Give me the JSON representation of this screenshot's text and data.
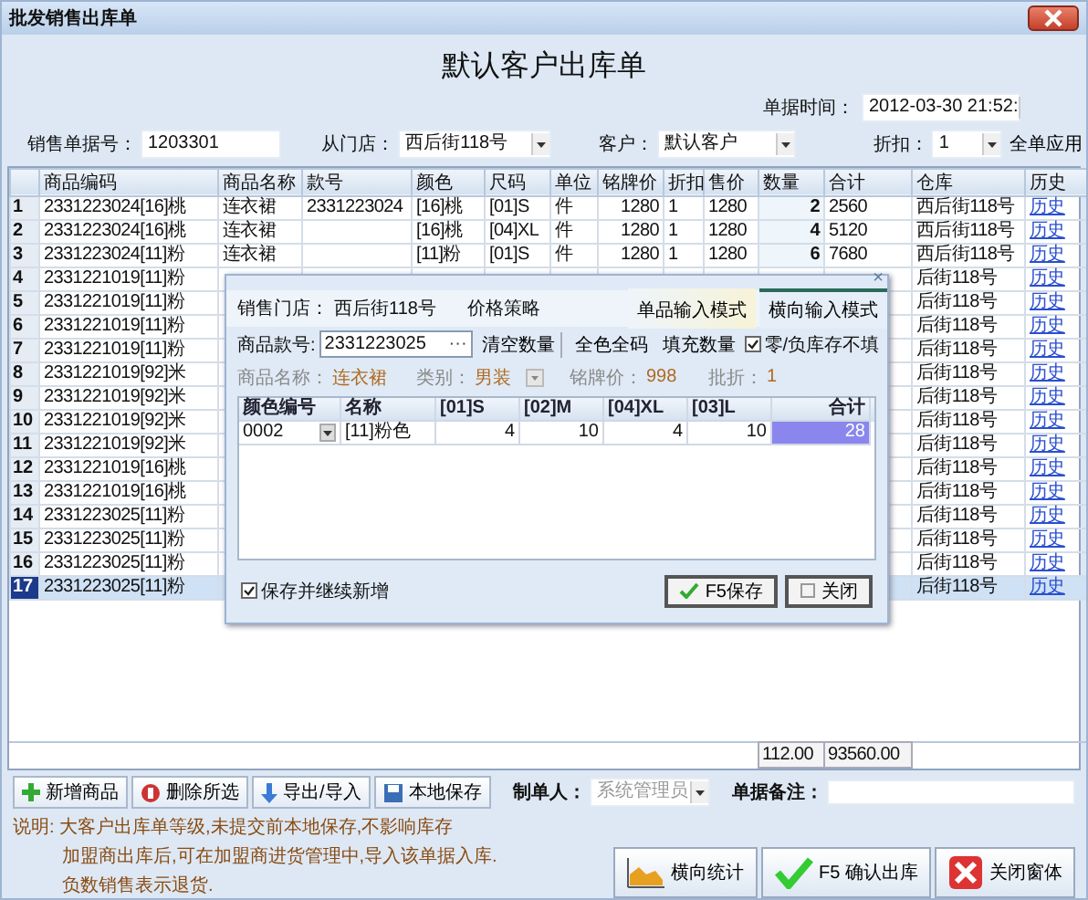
{
  "window": {
    "title": "批发销售出库单"
  },
  "heading": "默认客户出库单",
  "date": {
    "label": "单据时间：",
    "value": "2012-03-30 21:52:"
  },
  "fields": [
    {
      "kind": "input",
      "label": "销售单据号：",
      "value": "1203301"
    },
    {
      "kind": "combo",
      "label": "从门店：",
      "value": "西后街118号"
    },
    {
      "kind": "combo",
      "label": "客户：",
      "value": "默认客户"
    },
    {
      "kind": "combo",
      "label": "折扣：",
      "value": "1"
    }
  ],
  "apply_all": "全单应用",
  "table": {
    "columns": [
      "商品编码",
      "商品名称",
      "款号",
      "颜色",
      "尺码",
      "单位",
      "铭牌价",
      "折扣",
      "售价",
      "数量",
      "合计",
      "仓库",
      "历史"
    ],
    "rows": [
      {
        "no": "1",
        "code": "2331223024[16]桃",
        "name": "连衣裙",
        "style": "2331223024",
        "shade": "[16]桃",
        "size": "[01]S",
        "unit": "件",
        "list_price": "1280",
        "discount": "1",
        "price": "1280",
        "qty": "2",
        "total": "2560",
        "warehouse": "西后街118号",
        "history": "历史",
        "selected": false
      },
      {
        "no": "2",
        "code": "2331223024[16]桃",
        "name": "连衣裙",
        "shade": "[16]桃",
        "size": "[04]XL",
        "unit": "件",
        "list_price": "1280",
        "discount": "1",
        "price": "1280",
        "qty": "4",
        "total": "5120",
        "warehouse": "西后街118号",
        "history": "历史",
        "selected": false
      },
      {
        "no": "3",
        "code": "2331223024[11]粉",
        "name": "连衣裙",
        "shade": "[11]粉",
        "size": "[01]S",
        "unit": "件",
        "list_price": "1280",
        "discount": "1",
        "price": "1280",
        "qty": "6",
        "total": "7680",
        "warehouse": "西后街118号",
        "history": "历史",
        "selected": false
      },
      {
        "no": "4",
        "code": "2331221019[11]粉",
        "warehouse": "后街118号",
        "history": "历史",
        "selected": false
      },
      {
        "no": "5",
        "code": "2331221019[11]粉",
        "warehouse": "后街118号",
        "history": "历史",
        "selected": false
      },
      {
        "no": "6",
        "code": "2331221019[11]粉",
        "warehouse": "后街118号",
        "history": "历史",
        "selected": false
      },
      {
        "no": "7",
        "code": "2331221019[11]粉",
        "warehouse": "后街118号",
        "history": "历史",
        "selected": false
      },
      {
        "no": "8",
        "code": "2331221019[92]米",
        "warehouse": "后街118号",
        "history": "历史",
        "selected": false
      },
      {
        "no": "9",
        "code": "2331221019[92]米",
        "warehouse": "后街118号",
        "history": "历史",
        "selected": false
      },
      {
        "no": "10",
        "code": "2331221019[92]米",
        "warehouse": "后街118号",
        "history": "历史",
        "selected": false
      },
      {
        "no": "11",
        "code": "2331221019[92]米",
        "warehouse": "后街118号",
        "history": "历史",
        "selected": false
      },
      {
        "no": "12",
        "code": "2331221019[16]桃",
        "warehouse": "后街118号",
        "history": "历史",
        "selected": false
      },
      {
        "no": "13",
        "code": "2331221019[16]桃",
        "warehouse": "后街118号",
        "history": "历史",
        "selected": false
      },
      {
        "no": "14",
        "code": "2331223025[11]粉",
        "warehouse": "后街118号",
        "history": "历史",
        "selected": false
      },
      {
        "no": "15",
        "code": "2331223025[11]粉",
        "warehouse": "后街118号",
        "history": "历史",
        "selected": false
      },
      {
        "no": "16",
        "code": "2331223025[11]粉",
        "warehouse": "后街118号",
        "history": "历史",
        "selected": false
      },
      {
        "no": "17",
        "code": "2331223025[11]粉",
        "warehouse": "后街118号",
        "history": "历史",
        "selected": true
      }
    ],
    "summary": {
      "qty": "112.00",
      "total": "93560.00"
    }
  },
  "dialog": {
    "close_mark": "×",
    "store_label": "销售门店：",
    "store": "西后街118号",
    "price_policy": "价格策略",
    "tabs": [
      {
        "label": "单品输入模式",
        "selected": false
      },
      {
        "label": "横向输入模式",
        "selected": true
      }
    ],
    "style_label": "商品款号:",
    "style_value": "2331223025",
    "browse": "···",
    "actions": [
      "清空数量",
      "全色全码",
      "填充数量"
    ],
    "skip_empty": {
      "label": "零/负库存不填",
      "checked": true
    },
    "name_label": "商品名称：",
    "name": "连衣裙",
    "category_label": "类别：",
    "category": "男装",
    "list_price_label": "铭牌价：",
    "list_price": "998",
    "discount_label": "批折：",
    "discount": "1",
    "grid": {
      "columns": [
        "颜色编号",
        "名称",
        "[01]S",
        "[02]M",
        "[04]XL",
        "[03]L",
        "合计"
      ],
      "rows": [
        {
          "code": "0002",
          "name": "[11]粉色",
          "sizes": [
            "4",
            "10",
            "4",
            "10"
          ],
          "total": "28"
        }
      ]
    },
    "keep_adding": {
      "label": "保存并继续新增",
      "checked": true
    },
    "save": "F5保存",
    "close": "关闭"
  },
  "toolbar": [
    "新增商品",
    "删除所选",
    "导出/导入",
    "本地保存"
  ],
  "maker": {
    "label": "制单人：",
    "value": "系统管理员"
  },
  "remark": {
    "label": "单据备注："
  },
  "notes": [
    "说明: 大客户出库单等级,未提交前本地保存,不影响库存",
    "加盟商出库后,可在加盟商进货管理中,导入该单据入库.",
    "负数销售表示退货."
  ],
  "actions": [
    "横向统计",
    "F5 确认出库",
    "关闭窗体"
  ]
}
